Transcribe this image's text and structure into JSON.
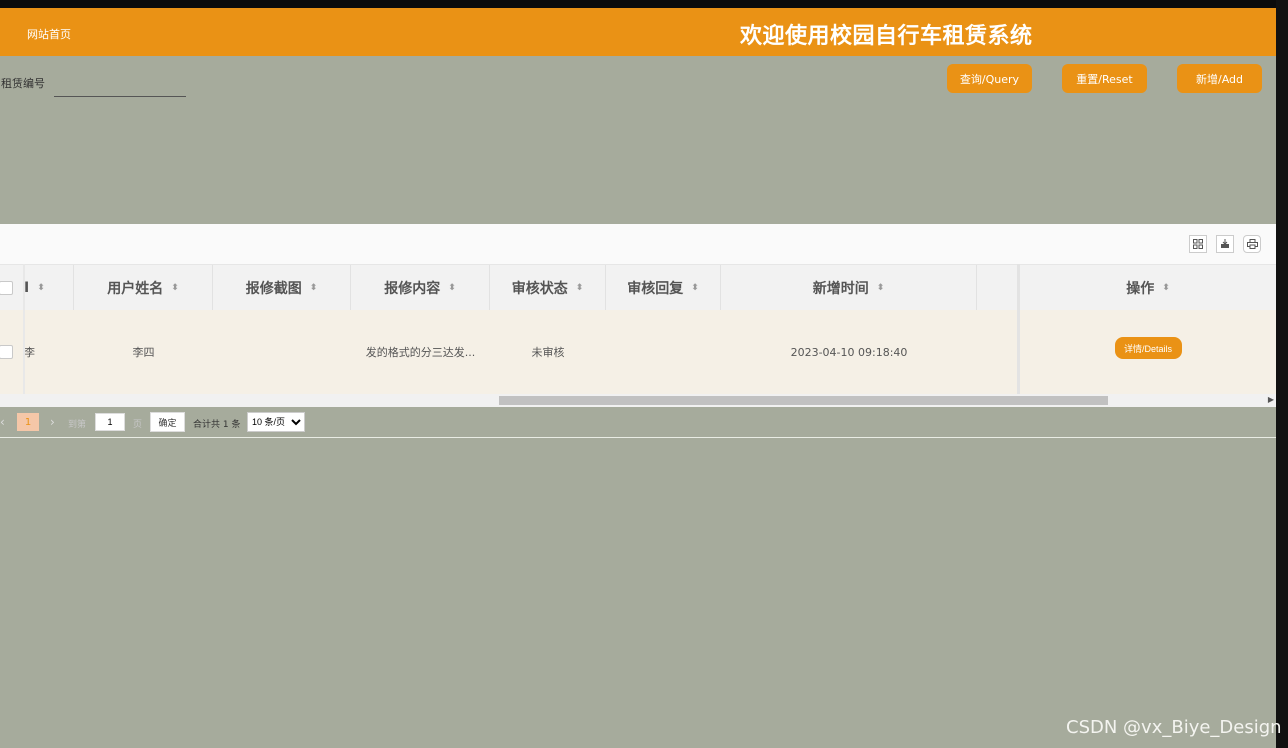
{
  "header": {
    "nav_home": "网站首页",
    "site_title": "欢迎使用校园自行车租赁系统"
  },
  "search": {
    "label": "租赁编号",
    "value": "",
    "buttons": {
      "query": "查询/Query",
      "reset": "重置/Reset",
      "add": "新增/Add"
    }
  },
  "toolbar_icons": [
    "columns-icon",
    "export-icon",
    "print-icon"
  ],
  "table": {
    "columns": [
      "用户姓名",
      "报修截图",
      "报修内容",
      "审核状态",
      "审核回复",
      "新增时间",
      "操作"
    ],
    "first_col_fragment": "I",
    "rows": [
      {
        "first_col": "李",
        "user_name": "李四",
        "screenshot": "",
        "content": "发的格式的分三达发...",
        "review_status": "未审核",
        "review_reply": "",
        "created_at": "2023-04-10 09:18:40",
        "action": "详情/Details"
      }
    ]
  },
  "pagination": {
    "current_page": "1",
    "goto_label": "到第",
    "goto_value": "1",
    "page_unit": "页",
    "confirm": "确定",
    "total": "合计共 1 条",
    "page_size": "10 条/页"
  },
  "watermark": "CSDN @vx_Biye_Design",
  "colors": {
    "accent": "#ea9215",
    "background": "#a6ab9c",
    "row_highlight": "#f5f0e6"
  }
}
